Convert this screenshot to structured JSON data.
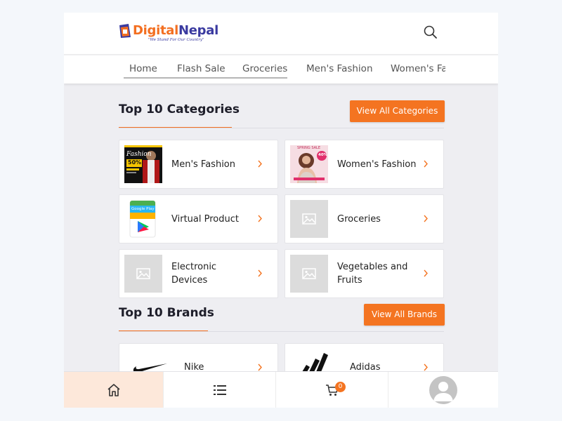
{
  "header": {
    "logo": {
      "word1": "Digital",
      "word2": "Nepal",
      "tagline": "\"We Stand For Our Country\""
    }
  },
  "nav": {
    "items": [
      "Home",
      "Flash Sale",
      "Groceries",
      "Men's Fashion",
      "Women's Fashion"
    ]
  },
  "categories": {
    "title": "Top 10 Categories",
    "view_all_label": "View All Categories",
    "items": [
      {
        "label": "Men's Fashion"
      },
      {
        "label": "Women's Fashion"
      },
      {
        "label": "Virtual Product"
      },
      {
        "label": "Groceries"
      },
      {
        "label": "Electronic Devices"
      },
      {
        "label": "Vegetables and Fruits"
      }
    ],
    "thumb_text": {
      "mens_title": "Fashion",
      "mens_discount": "50%",
      "womens_banner": "SPRING SALE",
      "womens_discount": "40%",
      "google_play": "Google Play"
    }
  },
  "brands": {
    "title": "Top 10 Brands",
    "view_all_label": "View All Brands",
    "items": [
      {
        "label": "Nike"
      },
      {
        "label": "Adidas"
      }
    ]
  },
  "bottom_nav": {
    "cart_count": "0",
    "icons": [
      "home-icon",
      "list-icon",
      "cart-icon",
      "avatar"
    ]
  },
  "colors": {
    "accent": "#f47421",
    "brand_blue": "#3a3aa0",
    "page_bg": "#eeeef2"
  }
}
